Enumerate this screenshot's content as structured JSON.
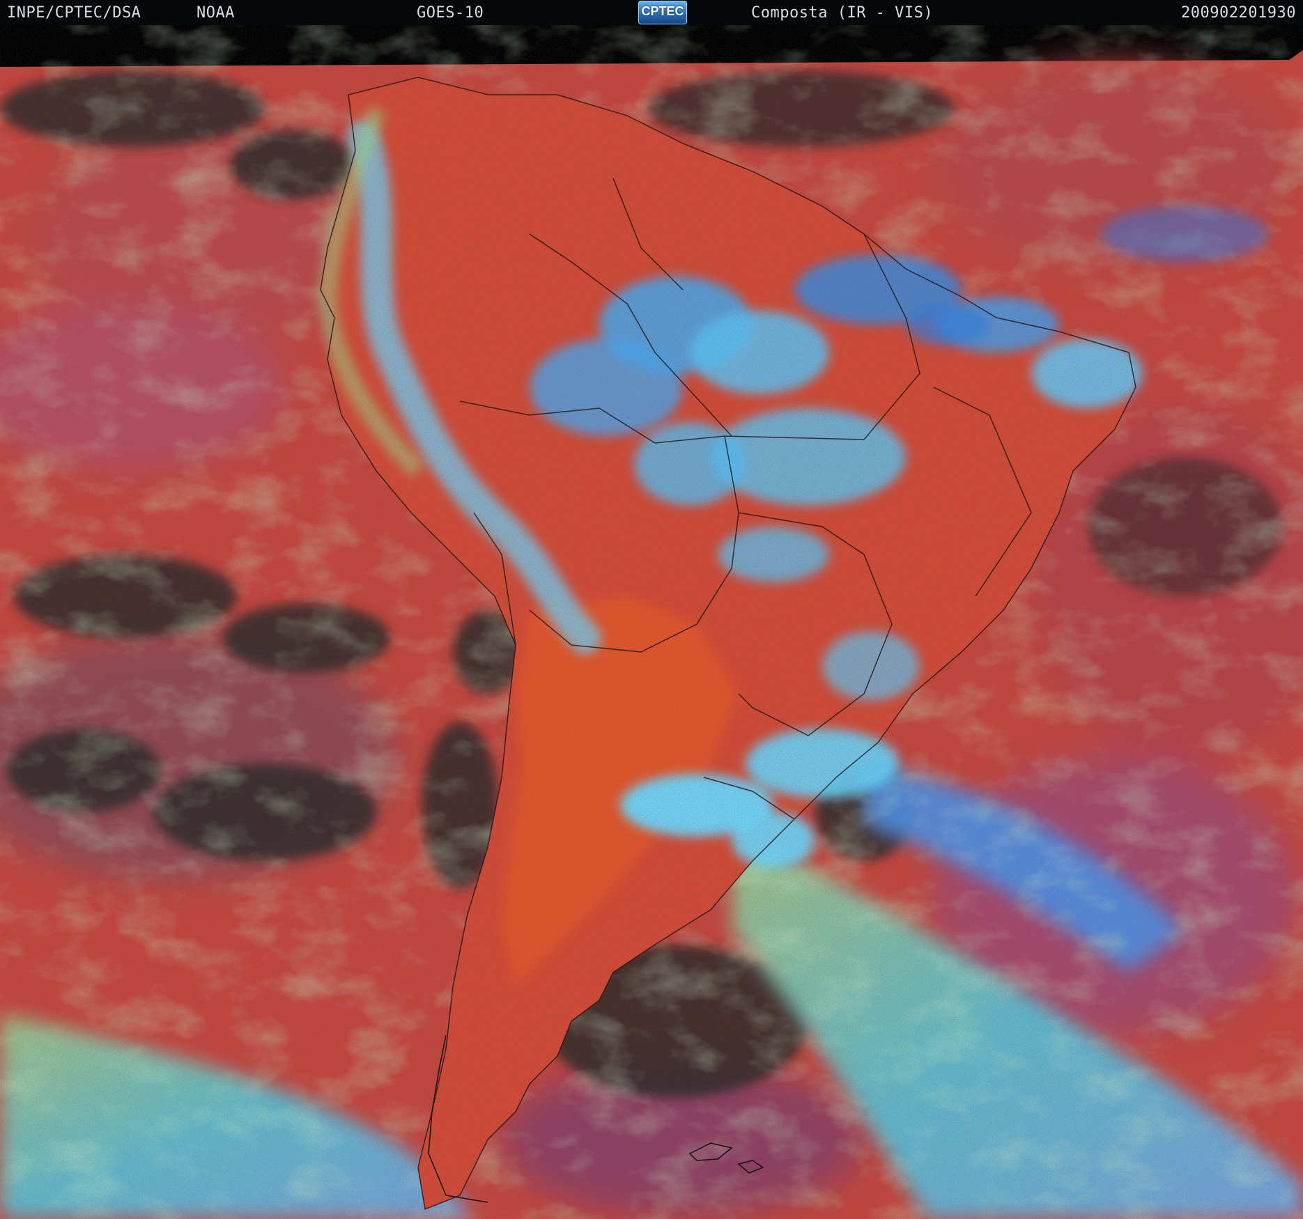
{
  "header": {
    "organization": "INPE/CPTEC/DSA",
    "agency": "NOAA",
    "satellite": "GOES-10",
    "logo_text": "CPTEC",
    "product": "Composta (IR - VIS)",
    "timestamp": "200902201930"
  },
  "colors": {
    "header_bg": "#05080b",
    "header_text": "#d8dde3",
    "ocean_clear": "#c8473d",
    "land_clear": "#d9502c",
    "low_cloud": "#8fc77a",
    "high_cloud": "#35a8f2",
    "deep_convection": "#5fdcff",
    "no_signal": "#2f2a2c"
  },
  "map": {
    "region": "South America",
    "projection_note": ""
  }
}
